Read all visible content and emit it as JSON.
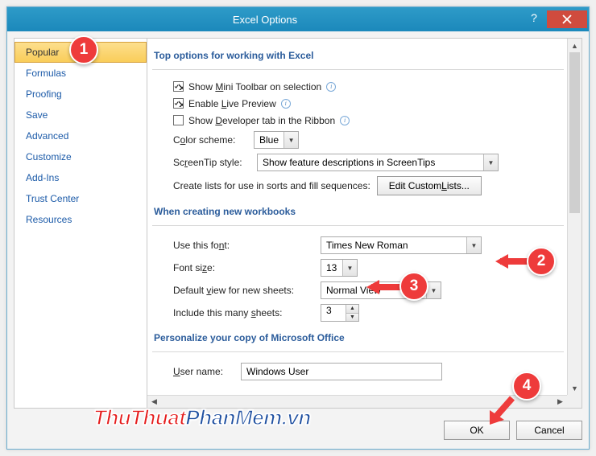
{
  "window": {
    "title": "Excel Options"
  },
  "sidebar": {
    "items": [
      {
        "label": "Popular",
        "selected": true
      },
      {
        "label": "Formulas"
      },
      {
        "label": "Proofing"
      },
      {
        "label": "Save"
      },
      {
        "label": "Advanced"
      },
      {
        "label": "Customize"
      },
      {
        "label": "Add-Ins"
      },
      {
        "label": "Trust Center"
      },
      {
        "label": "Resources"
      }
    ]
  },
  "sections": {
    "top": {
      "heading": "Top options for working with Excel",
      "mini_toolbar": {
        "label_pre": "Show ",
        "u": "M",
        "label_post": "ini Toolbar on selection",
        "checked": true
      },
      "live_preview": {
        "label_pre": "Enable ",
        "u": "L",
        "label_post": "ive Preview",
        "checked": true
      },
      "dev_tab": {
        "label_pre": "Show ",
        "u": "D",
        "label_post": "eveloper tab in the Ribbon",
        "checked": false
      },
      "color_scheme": {
        "label_pre": "C",
        "label_ul": "o",
        "label_post": "lor scheme:",
        "value": "Blue"
      },
      "screentip": {
        "label_pre": "Sc",
        "label_ul": "r",
        "label_post": "eenTip style:",
        "value": "Show feature descriptions in ScreenTips"
      },
      "custom_lists": {
        "label": "Create lists for use in sorts and fill sequences:",
        "button_pre": "Edit Custom ",
        "button_u": "L",
        "button_post": "ists..."
      }
    },
    "new_wb": {
      "heading": "When creating new workbooks",
      "font": {
        "label_pre": "Use this fo",
        "label_ul": "n",
        "label_post": "t:",
        "value": "Times New Roman"
      },
      "size": {
        "label_pre": "Font si",
        "label_ul": "z",
        "label_post": "e:",
        "value": "13"
      },
      "view": {
        "label_pre": "Default ",
        "label_ul": "v",
        "label_post": "iew for new sheets:",
        "value": "Normal View"
      },
      "sheets": {
        "label_pre": "Include this many ",
        "label_ul": "s",
        "label_post": "heets:",
        "value": "3"
      }
    },
    "personalize": {
      "heading": "Personalize your copy of Microsoft Office",
      "username": {
        "label_pre": "",
        "label_ul": "U",
        "label_post": "ser name:",
        "value": "Windows User"
      }
    }
  },
  "footer": {
    "ok": "OK",
    "cancel": "Cancel"
  },
  "watermark": {
    "p1": "ThuThuat",
    "p2": "PhanMem.vn"
  },
  "annotations": {
    "b1": "1",
    "b2": "2",
    "b3": "3",
    "b4": "4"
  }
}
